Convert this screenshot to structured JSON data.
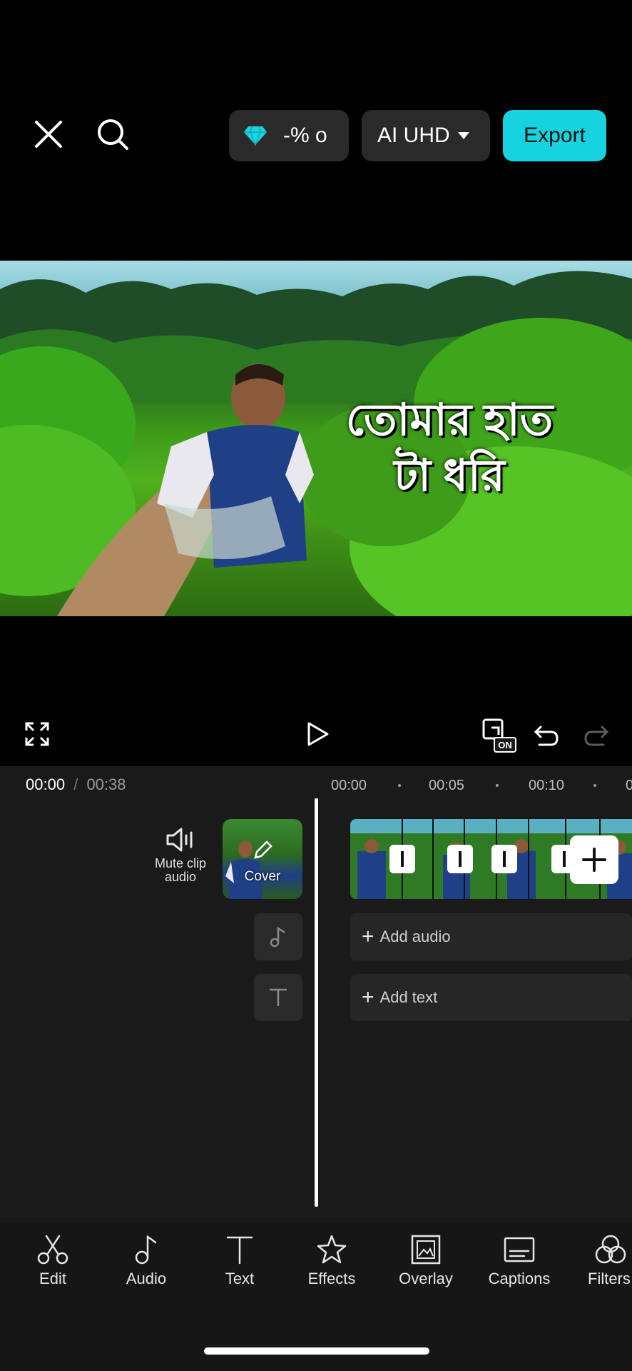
{
  "topbar": {
    "close_icon": "close-icon",
    "search_icon": "search-icon",
    "promo_text": "-% o",
    "resolution_label": "AI UHD",
    "export_label": "Export"
  },
  "preview": {
    "caption_line1": "তোমার হাত",
    "caption_line2": "টা ধরি"
  },
  "controls": {
    "current_time": "00:00",
    "separator": "/",
    "total_time": "00:38"
  },
  "ruler": {
    "marks": [
      "00:00",
      "00:05",
      "00:10"
    ]
  },
  "timeline": {
    "mute_label_line1": "Mute clip",
    "mute_label_line2": "audio",
    "cover_label": "Cover",
    "add_audio": "Add audio",
    "add_text": "Add text"
  },
  "toolbar": {
    "items": [
      {
        "label": "Edit",
        "icon": "scissors-icon"
      },
      {
        "label": "Audio",
        "icon": "music-note-icon"
      },
      {
        "label": "Text",
        "icon": "text-icon"
      },
      {
        "label": "Effects",
        "icon": "star-icon"
      },
      {
        "label": "Overlay",
        "icon": "overlay-icon"
      },
      {
        "label": "Captions",
        "icon": "captions-icon"
      },
      {
        "label": "Filters",
        "icon": "filters-icon"
      }
    ]
  },
  "colors": {
    "accent": "#17d3df",
    "background": "#000000",
    "panel": "#1a1a1a"
  }
}
